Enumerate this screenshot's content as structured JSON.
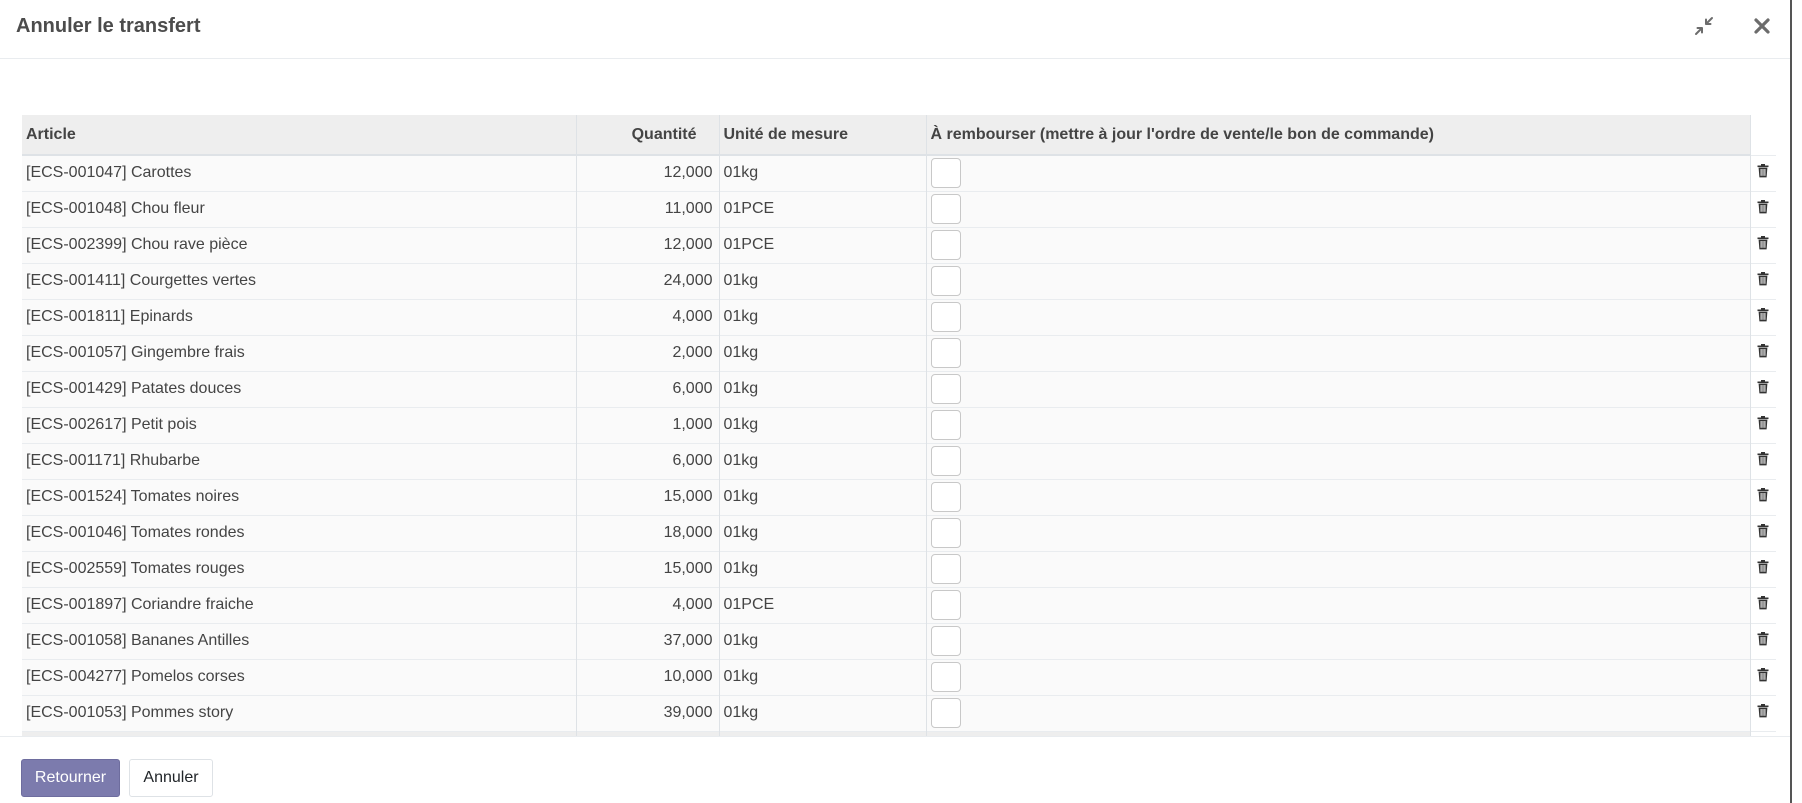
{
  "dialog": {
    "title": "Annuler le transfert",
    "expand_icon": "compress-icon",
    "close_icon": "close-icon"
  },
  "table": {
    "headers": {
      "article": "Article",
      "quantity": "Quantité",
      "uom": "Unité de mesure",
      "refund": "À rembourser (mettre à jour l'ordre de vente/le bon de commande)"
    },
    "rows": [
      {
        "article": "[ECS-001047] Carottes",
        "quantity": "12,000",
        "uom": "01kg",
        "refund": false
      },
      {
        "article": "[ECS-001048] Chou fleur",
        "quantity": "11,000",
        "uom": "01PCE",
        "refund": false
      },
      {
        "article": "[ECS-002399] Chou rave pièce",
        "quantity": "12,000",
        "uom": "01PCE",
        "refund": false
      },
      {
        "article": "[ECS-001411] Courgettes vertes",
        "quantity": "24,000",
        "uom": "01kg",
        "refund": false
      },
      {
        "article": "[ECS-001811] Epinards",
        "quantity": "4,000",
        "uom": "01kg",
        "refund": false
      },
      {
        "article": "[ECS-001057] Gingembre frais",
        "quantity": "2,000",
        "uom": "01kg",
        "refund": false
      },
      {
        "article": "[ECS-001429] Patates douces",
        "quantity": "6,000",
        "uom": "01kg",
        "refund": false
      },
      {
        "article": "[ECS-002617] Petit pois",
        "quantity": "1,000",
        "uom": "01kg",
        "refund": false
      },
      {
        "article": "[ECS-001171] Rhubarbe",
        "quantity": "6,000",
        "uom": "01kg",
        "refund": false
      },
      {
        "article": "[ECS-001524] Tomates noires",
        "quantity": "15,000",
        "uom": "01kg",
        "refund": false
      },
      {
        "article": "[ECS-001046] Tomates rondes",
        "quantity": "18,000",
        "uom": "01kg",
        "refund": false
      },
      {
        "article": "[ECS-002559] Tomates rouges",
        "quantity": "15,000",
        "uom": "01kg",
        "refund": false
      },
      {
        "article": "[ECS-001897] Coriandre fraiche",
        "quantity": "4,000",
        "uom": "01PCE",
        "refund": false
      },
      {
        "article": "[ECS-001058] Bananes Antilles",
        "quantity": "37,000",
        "uom": "01kg",
        "refund": false
      },
      {
        "article": "[ECS-004277] Pomelos corses",
        "quantity": "10,000",
        "uom": "01kg",
        "refund": false
      },
      {
        "article": "[ECS-001053] Pommes story",
        "quantity": "39,000",
        "uom": "01kg",
        "refund": false
      }
    ],
    "row_action_icon": "trash-icon"
  },
  "footer": {
    "submit_label": "Retourner",
    "cancel_label": "Annuler"
  },
  "colors": {
    "primary": "#7c7bad",
    "header_bg": "#eeeeee"
  }
}
